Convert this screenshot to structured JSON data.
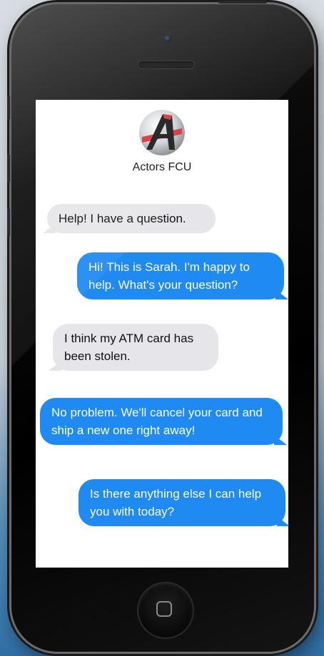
{
  "contact": {
    "name": "Actors FCU",
    "avatar_icon": "actors-fcu-logo"
  },
  "colors": {
    "outgoing_bubble": "#1e8af2",
    "incoming_bubble": "#e6e6ea",
    "screen_background": "#ffffff"
  },
  "messages": [
    {
      "direction": "incoming",
      "text": "Help! I have a question."
    },
    {
      "direction": "outgoing",
      "text": "Hi! This is Sarah. I'm happy to help. What's your question?"
    },
    {
      "direction": "incoming",
      "text": "I think my ATM card has been stolen."
    },
    {
      "direction": "outgoing",
      "text": "No problem. We'll cancel your card and ship a new one right away!"
    },
    {
      "direction": "outgoing",
      "text": "Is there anything else I can help you with today?"
    }
  ],
  "device": {
    "home_button_icon": "home-square-icon",
    "camera_icon": "front-camera-icon"
  }
}
